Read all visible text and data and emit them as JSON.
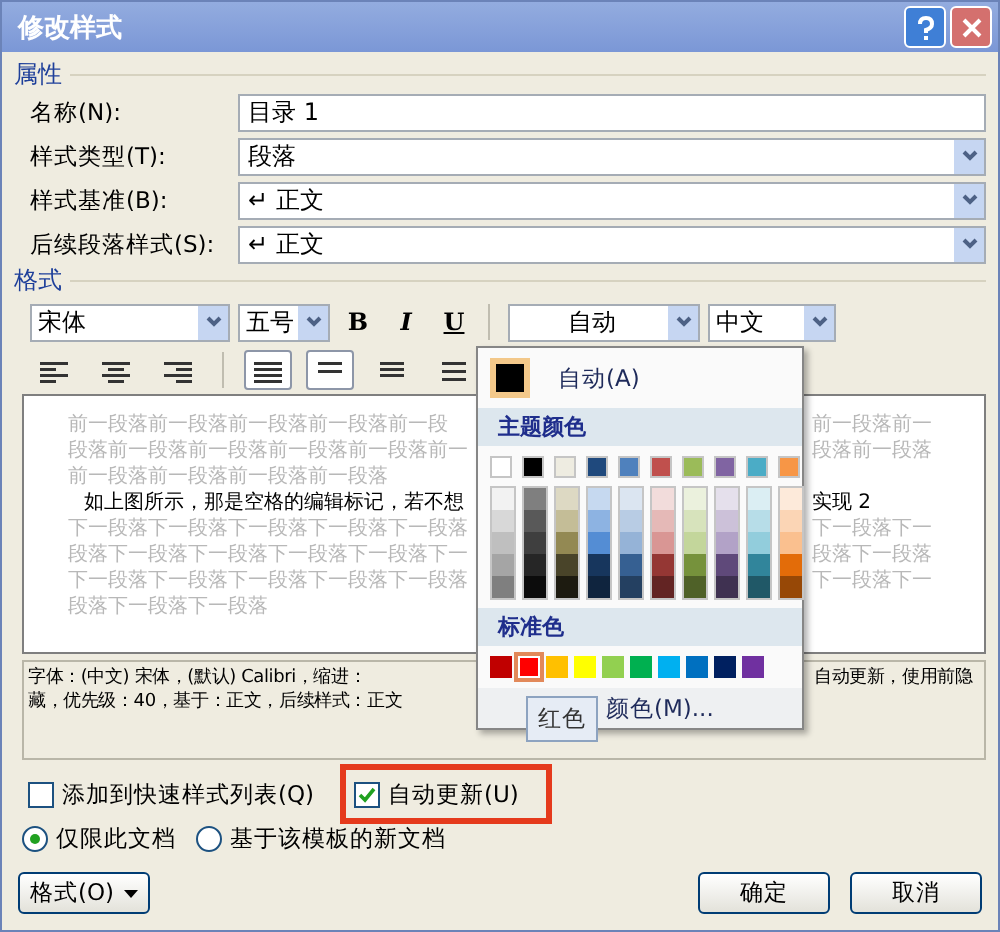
{
  "window": {
    "title": "修改样式"
  },
  "properties": {
    "heading": "属性",
    "fields": [
      {
        "label": "名称(N):",
        "value": "目录 1",
        "kind": "text"
      },
      {
        "label": "样式类型(T):",
        "value": "段落",
        "kind": "dropdown"
      },
      {
        "label": "样式基准(B):",
        "value": "↵ 正文",
        "kind": "dropdown"
      },
      {
        "label": "后续段落样式(S):",
        "value": "↵ 正文",
        "kind": "dropdown"
      }
    ]
  },
  "format": {
    "heading": "格式",
    "font": "宋体",
    "size": "五号",
    "styles": [
      "B",
      "I",
      "U"
    ],
    "color_label": "自动",
    "language": "中文",
    "tools": [
      {
        "kind": "align-left",
        "selected": false
      },
      {
        "kind": "align-center",
        "selected": false
      },
      {
        "kind": "align-right",
        "selected": false
      },
      {
        "kind": "justify",
        "selected": true
      },
      {
        "kind": "spacing-single",
        "selected": true
      },
      {
        "kind": "spacing-half",
        "selected": false
      },
      {
        "kind": "spacing-double",
        "selected": false
      }
    ]
  },
  "preview": {
    "lines": [
      {
        "kind": "before",
        "left": "前一段落前一段落前一段落前一段落前一段",
        "right": "前一段落前一"
      },
      {
        "kind": "before",
        "left": "段落前一段落前一段落前一段落前一段落前一",
        "right": "段落前一段落"
      },
      {
        "kind": "before",
        "left": "前一段落前一段落前一段落前一段落"
      },
      {
        "kind": "current",
        "left": "如上图所示，那是空格的编辑标记，若不想",
        "right": "实现 2"
      },
      {
        "kind": "after",
        "left": "下一段落下一段落下一段落下一段落下一段落",
        "right": "下一段落下一"
      },
      {
        "kind": "after",
        "left": "段落下一段落下一段落下一段落下一段落下一",
        "right": "段落下一段落"
      },
      {
        "kind": "after",
        "left": "下一段落下一段落下一段落下一段落下一段落",
        "right": "下一段落下一"
      },
      {
        "kind": "after",
        "left": "段落下一段落下一段落"
      }
    ]
  },
  "description": {
    "lines": [
      {
        "left": "字体：(中文) 宋体，(默认) Calibri，缩进：",
        "right": "自动更新，使用前隐"
      },
      {
        "left": "藏，优先级：40，基于：正文，后续样式：正文"
      }
    ]
  },
  "color_menu": {
    "auto": {
      "label": "自动(A)",
      "color": "#000000"
    },
    "theme_heading": "主题颜色",
    "theme": [
      {
        "color": "#ffffff",
        "shades": [
          {
            "color": "#f2f2f2"
          },
          {
            "color": "#d8d8d8"
          },
          {
            "color": "#bfbfbf"
          },
          {
            "color": "#a5a5a5"
          },
          {
            "color": "#7f7f7f"
          }
        ]
      },
      {
        "color": "#000000",
        "shades": [
          {
            "color": "#7f7f7f"
          },
          {
            "color": "#595959"
          },
          {
            "color": "#3f3f3f"
          },
          {
            "color": "#262626"
          },
          {
            "color": "#0c0c0c"
          }
        ]
      },
      {
        "color": "#eeece1",
        "shades": [
          {
            "color": "#ddd9c3"
          },
          {
            "color": "#c4bd97"
          },
          {
            "color": "#938953"
          },
          {
            "color": "#494429"
          },
          {
            "color": "#1d1b10"
          }
        ]
      },
      {
        "color": "#1f497d",
        "shades": [
          {
            "color": "#c6d9f0"
          },
          {
            "color": "#8db3e2"
          },
          {
            "color": "#548dd4"
          },
          {
            "color": "#17365d"
          },
          {
            "color": "#0f243e"
          }
        ]
      },
      {
        "color": "#4f81bd",
        "shades": [
          {
            "color": "#dbe5f1"
          },
          {
            "color": "#b8cce4"
          },
          {
            "color": "#95b3d7"
          },
          {
            "color": "#366092"
          },
          {
            "color": "#244061"
          }
        ]
      },
      {
        "color": "#c0504d",
        "shades": [
          {
            "color": "#f2dcdb"
          },
          {
            "color": "#e5b9b7"
          },
          {
            "color": "#d99694"
          },
          {
            "color": "#953734"
          },
          {
            "color": "#632423"
          }
        ]
      },
      {
        "color": "#9bbb59",
        "shades": [
          {
            "color": "#ebf1dd"
          },
          {
            "color": "#d7e3bc"
          },
          {
            "color": "#c3d69b"
          },
          {
            "color": "#76923c"
          },
          {
            "color": "#4f6128"
          }
        ]
      },
      {
        "color": "#8064a2",
        "shades": [
          {
            "color": "#e5e0ec"
          },
          {
            "color": "#ccc1d9"
          },
          {
            "color": "#b2a2c7"
          },
          {
            "color": "#5f497a"
          },
          {
            "color": "#3f3151"
          }
        ]
      },
      {
        "color": "#4bacc6",
        "shades": [
          {
            "color": "#dbeef3"
          },
          {
            "color": "#b7dde8"
          },
          {
            "color": "#92cddc"
          },
          {
            "color": "#31859b"
          },
          {
            "color": "#205867"
          }
        ]
      },
      {
        "color": "#f79646",
        "shades": [
          {
            "color": "#fdeada"
          },
          {
            "color": "#fbd5b5"
          },
          {
            "color": "#fac08f"
          },
          {
            "color": "#e36c09"
          },
          {
            "color": "#974806"
          }
        ]
      }
    ],
    "standard_heading": "标准色",
    "standard": [
      {
        "color": "#c00000",
        "selected": false
      },
      {
        "color": "#ff0000",
        "selected": true
      },
      {
        "color": "#ffc000",
        "selected": false
      },
      {
        "color": "#ffff00",
        "selected": false
      },
      {
        "color": "#92d050",
        "selected": false
      },
      {
        "color": "#00b050",
        "selected": false
      },
      {
        "color": "#00b0f0",
        "selected": false
      },
      {
        "color": "#0070c0",
        "selected": false
      },
      {
        "color": "#002060",
        "selected": false
      },
      {
        "color": "#7030a0",
        "selected": false
      }
    ],
    "more": "颜色(M)...",
    "tooltip": "红色"
  },
  "checkboxes": [
    {
      "label": "添加到快速样式列表(Q)",
      "checked": false,
      "highlighted": false
    },
    {
      "label": "自动更新(U)",
      "checked": true,
      "highlighted": true
    }
  ],
  "radios": [
    {
      "label": "仅限此文档",
      "selected": true
    },
    {
      "label": "基于该模板的新文档",
      "selected": false
    }
  ],
  "buttons": {
    "format": "格式(O)",
    "ok": "确定",
    "cancel": "取消"
  }
}
